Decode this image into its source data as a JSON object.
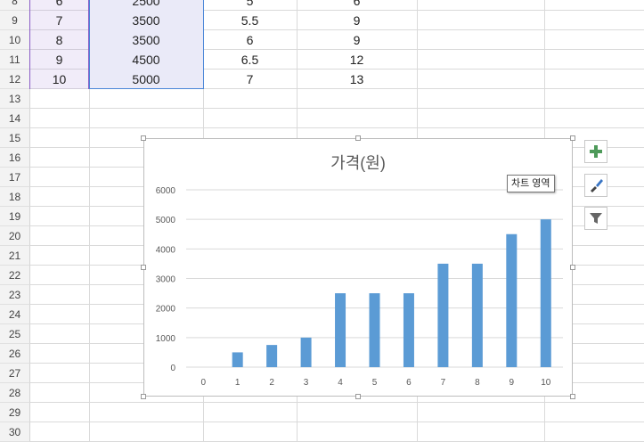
{
  "row_numbers": [
    "8",
    "9",
    "10",
    "11",
    "12",
    "13",
    "14",
    "15",
    "16",
    "17",
    "18",
    "19",
    "20",
    "21",
    "22",
    "23",
    "24",
    "25",
    "26",
    "27",
    "28",
    "29",
    "30"
  ],
  "table_rows": [
    {
      "a": "6",
      "b": "2500",
      "c": "5",
      "d": "6"
    },
    {
      "a": "7",
      "b": "3500",
      "c": "5.5",
      "d": "9"
    },
    {
      "a": "8",
      "b": "3500",
      "c": "6",
      "d": "9"
    },
    {
      "a": "9",
      "b": "4500",
      "c": "6.5",
      "d": "12"
    },
    {
      "a": "10",
      "b": "5000",
      "c": "7",
      "d": "13"
    }
  ],
  "chart_tooltip": "차트 영역",
  "side_buttons": {
    "add": "plus-icon",
    "style": "brush-icon",
    "filter": "filter-icon"
  },
  "colors": {
    "bar": "#5b9bd5",
    "selection": "#4a86d8",
    "grid": "#dadada"
  },
  "chart_data": {
    "type": "bar",
    "title": "가격(원)",
    "categories": [
      "0",
      "1",
      "2",
      "3",
      "4",
      "5",
      "6",
      "7",
      "8",
      "9",
      "10"
    ],
    "series": [
      {
        "name": "가격(원)",
        "values": [
          0,
          500,
          750,
          1000,
          2500,
          2500,
          2500,
          3500,
          3500,
          4500,
          5000
        ]
      }
    ],
    "yticks": [
      "0",
      "1000",
      "2000",
      "3000",
      "4000",
      "5000",
      "6000"
    ],
    "ylim": [
      0,
      6000
    ],
    "grid": true
  }
}
